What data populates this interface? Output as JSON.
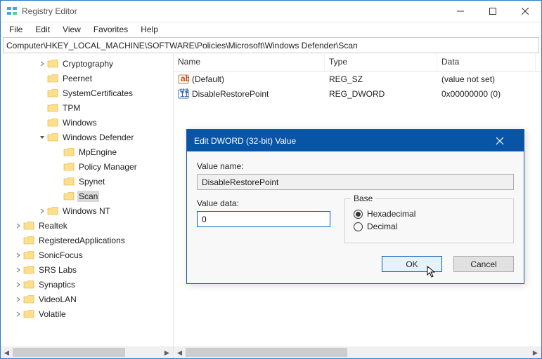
{
  "window": {
    "title": "Registry Editor"
  },
  "menu": {
    "file": "File",
    "edit": "Edit",
    "view": "View",
    "favorites": "Favorites",
    "help": "Help"
  },
  "address": "Computer\\HKEY_LOCAL_MACHINE\\SOFTWARE\\Policies\\Microsoft\\Windows Defender\\Scan",
  "tree": [
    {
      "indent": 52,
      "chev": ">",
      "label": "Cryptography"
    },
    {
      "indent": 52,
      "chev": "",
      "label": "Peernet"
    },
    {
      "indent": 52,
      "chev": "",
      "label": "SystemCertificates"
    },
    {
      "indent": 52,
      "chev": "",
      "label": "TPM"
    },
    {
      "indent": 52,
      "chev": "",
      "label": "Windows"
    },
    {
      "indent": 52,
      "chev": "v",
      "label": "Windows Defender"
    },
    {
      "indent": 75,
      "chev": "",
      "label": "MpEngine"
    },
    {
      "indent": 75,
      "chev": "",
      "label": "Policy Manager"
    },
    {
      "indent": 75,
      "chev": "",
      "label": "Spynet"
    },
    {
      "indent": 75,
      "chev": "",
      "label": "Scan",
      "selected": true
    },
    {
      "indent": 52,
      "chev": ">",
      "label": "Windows NT"
    },
    {
      "indent": 18,
      "chev": ">",
      "label": "Realtek"
    },
    {
      "indent": 18,
      "chev": "",
      "label": "RegisteredApplications"
    },
    {
      "indent": 18,
      "chev": ">",
      "label": "SonicFocus"
    },
    {
      "indent": 18,
      "chev": ">",
      "label": "SRS Labs"
    },
    {
      "indent": 18,
      "chev": ">",
      "label": "Synaptics"
    },
    {
      "indent": 18,
      "chev": ">",
      "label": "VideoLAN"
    },
    {
      "indent": 18,
      "chev": ">",
      "label": "Volatile"
    }
  ],
  "columns": {
    "name": "Name",
    "type": "Type",
    "data": "Data"
  },
  "col_widths": {
    "name": 215,
    "type": 160,
    "data": 140
  },
  "values": [
    {
      "icon": "string",
      "name": "(Default)",
      "type": "REG_SZ",
      "data": "(value not set)"
    },
    {
      "icon": "dword",
      "name": "DisableRestorePoint",
      "type": "REG_DWORD",
      "data": "0x00000000 (0)"
    }
  ],
  "dialog": {
    "title": "Edit DWORD (32-bit) Value",
    "value_name_label": "Value name:",
    "value_name": "DisableRestorePoint",
    "value_data_label": "Value data:",
    "value_data": "0",
    "base_label": "Base",
    "hex": "Hexadecimal",
    "dec": "Decimal",
    "base_selected": "hex",
    "ok": "OK",
    "cancel": "Cancel"
  }
}
